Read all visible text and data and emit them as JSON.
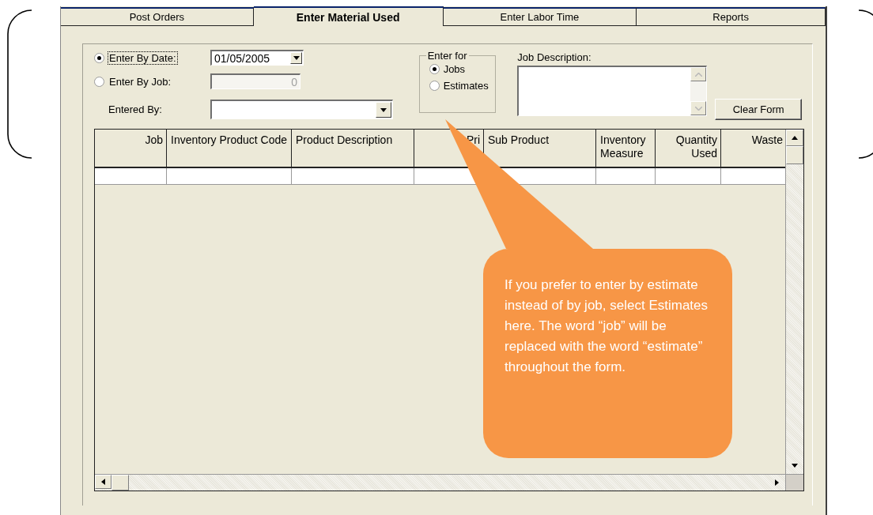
{
  "tabs": [
    {
      "label": "Post Orders",
      "selected": false
    },
    {
      "label": "Enter Material Used",
      "selected": true
    },
    {
      "label": "Enter Labor Time",
      "selected": false
    },
    {
      "label": "Reports",
      "selected": false
    }
  ],
  "entry_mode": [
    {
      "label": "Enter By Date:",
      "selected": true,
      "focused": true
    },
    {
      "label": "Enter By Job:",
      "selected": false,
      "focused": false
    }
  ],
  "date_field": {
    "value": "01/05/2005"
  },
  "job_field": {
    "value": "0",
    "disabled": true
  },
  "entered_by": {
    "label": "Entered By:"
  },
  "enter_for": {
    "title": "Enter for",
    "options": [
      {
        "label": "Jobs",
        "selected": true
      },
      {
        "label": "Estimates",
        "selected": false
      }
    ]
  },
  "job_description": {
    "label": "Job Description:"
  },
  "clear_button": "Clear Form",
  "table": {
    "columns": [
      "Job",
      "Inventory Product Code",
      "Product Description",
      "Pri",
      "Sub Product",
      "Inventory Measure",
      "Quantity Used",
      "Waste"
    ]
  },
  "callout": {
    "text": "If you prefer to enter by estimate instead of by job, select Estimates here. The word “job” will be replaced with the word “estimate” throughout the form."
  }
}
